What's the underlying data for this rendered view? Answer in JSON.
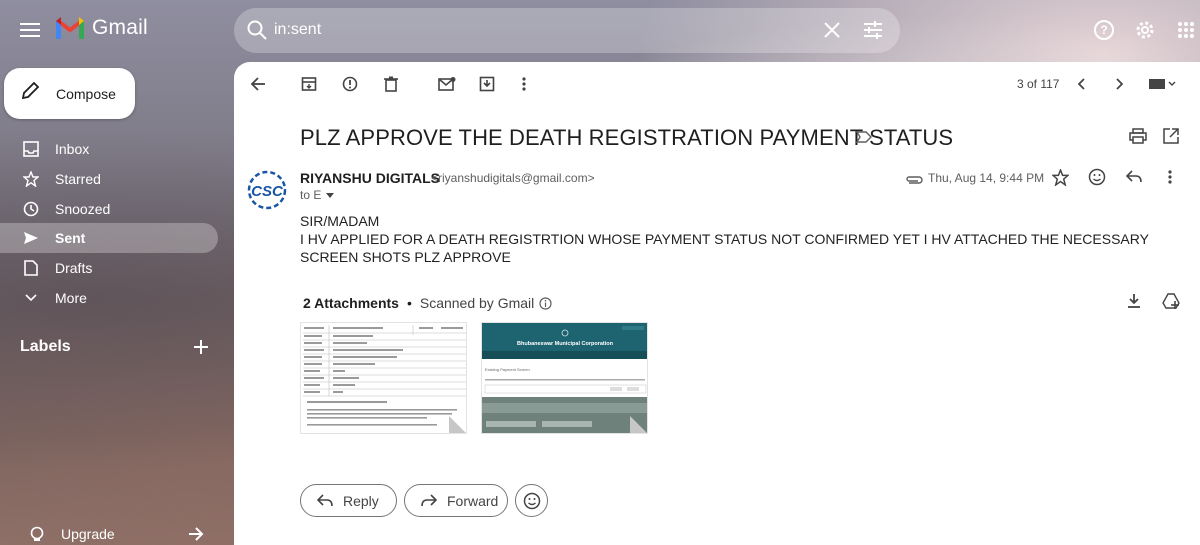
{
  "app": {
    "name": "Gmail"
  },
  "search": {
    "query": "in:sent"
  },
  "sidebar": {
    "compose_label": "Compose",
    "items": [
      {
        "label": "Inbox",
        "icon": "inbox-icon"
      },
      {
        "label": "Starred",
        "icon": "star-icon"
      },
      {
        "label": "Snoozed",
        "icon": "clock-icon"
      },
      {
        "label": "Sent",
        "icon": "send-icon",
        "active": true
      },
      {
        "label": "Drafts",
        "icon": "draft-icon"
      },
      {
        "label": "More",
        "icon": "chevron-down-icon"
      }
    ],
    "labels_title": "Labels",
    "upgrade_label": "Upgrade"
  },
  "toolbar": {
    "pager": "3 of 117"
  },
  "email": {
    "subject": "PLZ APPROVE THE DEATH REGISTRATION PAYMENT STATUS",
    "sender_name": "RIYANSHU DIGITALS",
    "sender_email": "<riyanshudigitals@gmail.com>",
    "to": "to E",
    "date": "Thu, Aug 14, 9:44 PM",
    "body_line1": "SIR/MADAM",
    "body_line2": "I HV APPLIED FOR A DEATH REGISTRTION WHOSE PAYMENT STATUS NOT CONFIRMED YET I HV ATTACHED THE NECESSARY SCREEN SHOTS PLZ APPROVE",
    "avatar_text": "CSC"
  },
  "attachments": {
    "count_label": "2 Attachments",
    "dot": "•",
    "scanned_label": "Scanned by Gmail",
    "thumb2_header": "Bhubaneswar Municipal Corporation",
    "thumb2_sub": "Existing Payment Screen"
  },
  "actions": {
    "reply": "Reply",
    "forward": "Forward"
  },
  "colors": {
    "accent_blue": "#0b57d0",
    "gmail_red": "#ea4335",
    "thumb_teal": "#1e6470"
  }
}
